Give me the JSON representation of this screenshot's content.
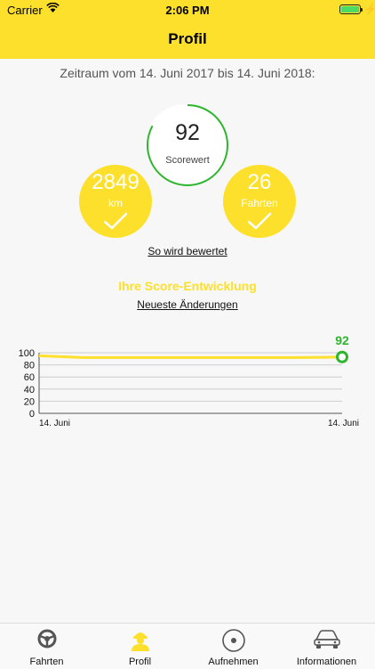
{
  "status_bar": {
    "carrier": "Carrier",
    "time": "2:06 PM"
  },
  "nav": {
    "title": "Profil"
  },
  "period_text": "Zeitraum vom 14. Juni 2017 bis 14. Juni 2018:",
  "score": {
    "value": "92",
    "label": "Scorewert"
  },
  "distance": {
    "value": "2849",
    "unit": "km"
  },
  "trips": {
    "value": "26",
    "label": "Fahrten"
  },
  "links": {
    "how_rated": "So wird bewertet",
    "latest_changes": "Neueste Änderungen"
  },
  "score_section": {
    "title": "Ihre Score-Entwicklung"
  },
  "chart_data": {
    "type": "line",
    "x": [
      "14. Juni",
      "14. Juni"
    ],
    "series": [
      {
        "values": [
          95,
          92,
          92,
          92,
          92,
          92,
          92,
          93
        ]
      }
    ],
    "y_ticks": [
      0,
      20,
      40,
      60,
      80,
      100
    ],
    "ylim": [
      0,
      100
    ],
    "end_label": "92",
    "grid": true,
    "colors": {
      "line": "#fde02b",
      "end_marker": "#2db52d"
    }
  },
  "tabs": [
    {
      "label": "Fahrten",
      "icon": "steering-wheel-icon"
    },
    {
      "label": "Profil",
      "icon": "driver-icon",
      "active": true
    },
    {
      "label": "Aufnehmen",
      "icon": "record-icon"
    },
    {
      "label": "Informationen",
      "icon": "car-icon"
    }
  ],
  "colors": {
    "accent": "#fde02b",
    "score_ring": "#2db52d"
  }
}
